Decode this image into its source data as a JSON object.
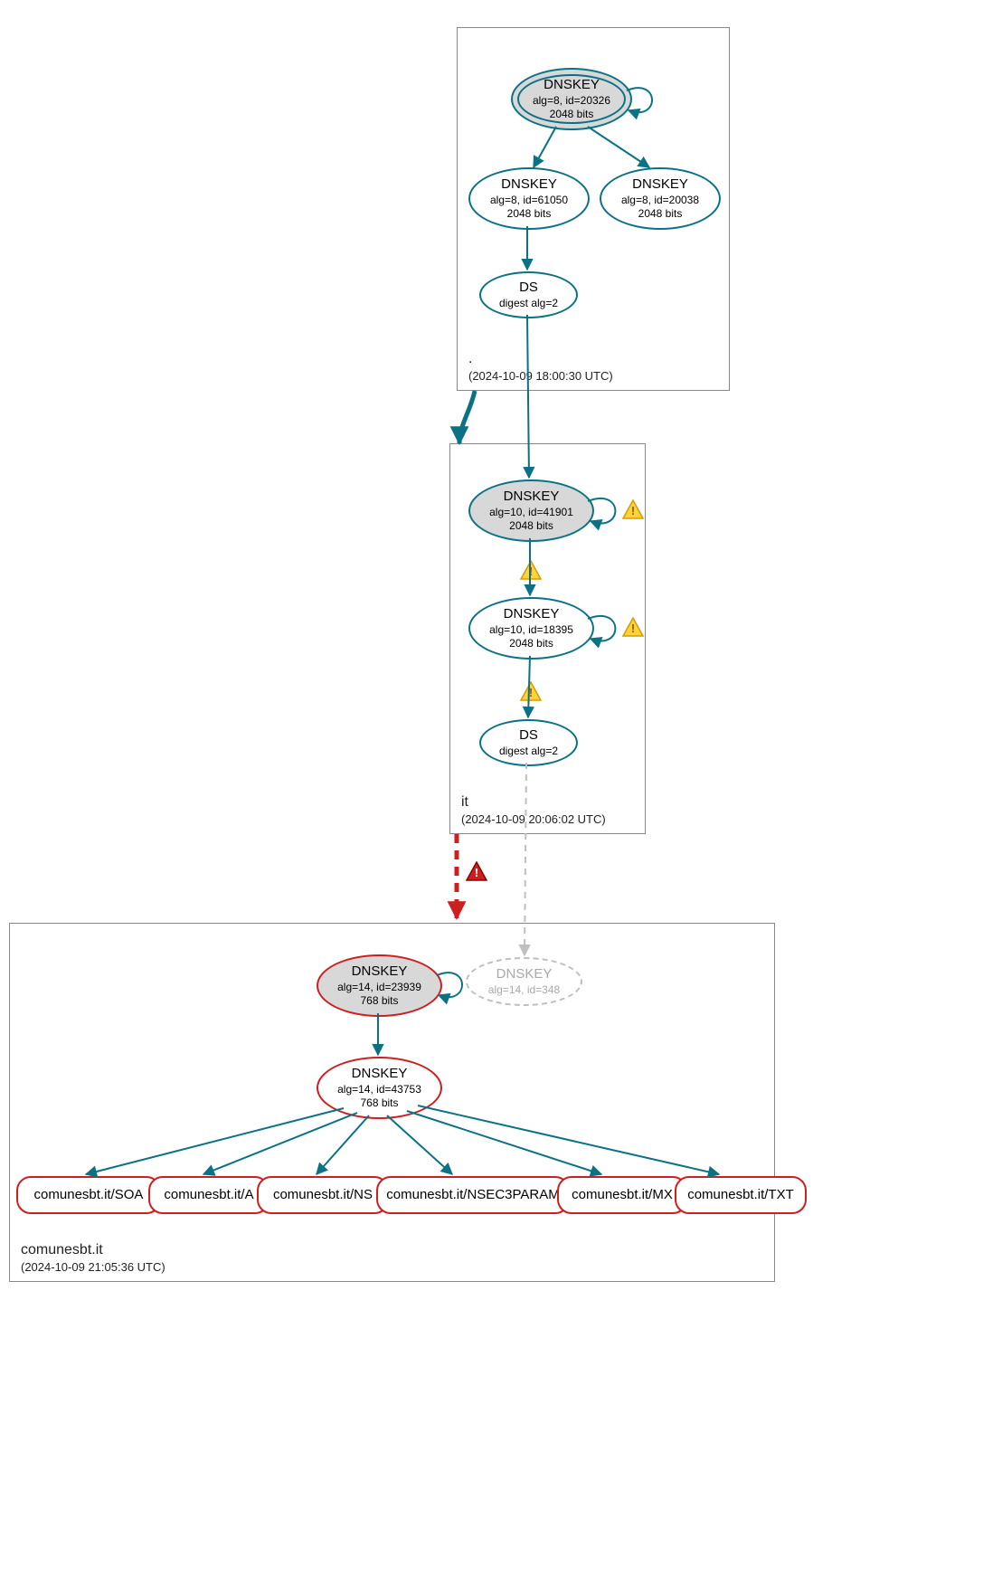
{
  "zones": {
    "root": {
      "name": ".",
      "timestamp": "(2024-10-09 18:00:30 UTC)"
    },
    "it": {
      "name": "it",
      "timestamp": "(2024-10-09 20:06:02 UTC)"
    },
    "leaf": {
      "name": "comunesbt.it",
      "timestamp": "(2024-10-09 21:05:36 UTC)"
    }
  },
  "nodes": {
    "root_ksk": {
      "title": "DNSKEY",
      "line1": "alg=8, id=20326",
      "line2": "2048 bits"
    },
    "root_zsk1": {
      "title": "DNSKEY",
      "line1": "alg=8, id=61050",
      "line2": "2048 bits"
    },
    "root_zsk2": {
      "title": "DNSKEY",
      "line1": "alg=8, id=20038",
      "line2": "2048 bits"
    },
    "root_ds": {
      "title": "DS",
      "line1": "digest alg=2"
    },
    "it_ksk": {
      "title": "DNSKEY",
      "line1": "alg=10, id=41901",
      "line2": "2048 bits"
    },
    "it_zsk": {
      "title": "DNSKEY",
      "line1": "alg=10, id=18395",
      "line2": "2048 bits"
    },
    "it_ds": {
      "title": "DS",
      "line1": "digest alg=2"
    },
    "leaf_ksk": {
      "title": "DNSKEY",
      "line1": "alg=14, id=23939",
      "line2": "768 bits"
    },
    "leaf_missing": {
      "title": "DNSKEY",
      "line1": "alg=14, id=348"
    },
    "leaf_zsk": {
      "title": "DNSKEY",
      "line1": "alg=14, id=43753",
      "line2": "768 bits"
    },
    "rr_soa": "comunesbt.it/SOA",
    "rr_a": "comunesbt.it/A",
    "rr_ns": "comunesbt.it/NS",
    "rr_n3p": "comunesbt.it/NSEC3PARAM",
    "rr_mx": "comunesbt.it/MX",
    "rr_txt": "comunesbt.it/TXT"
  },
  "colors": {
    "teal": "#0b7285",
    "red": "#cc1f1f",
    "gray": "#bfbfbf"
  }
}
